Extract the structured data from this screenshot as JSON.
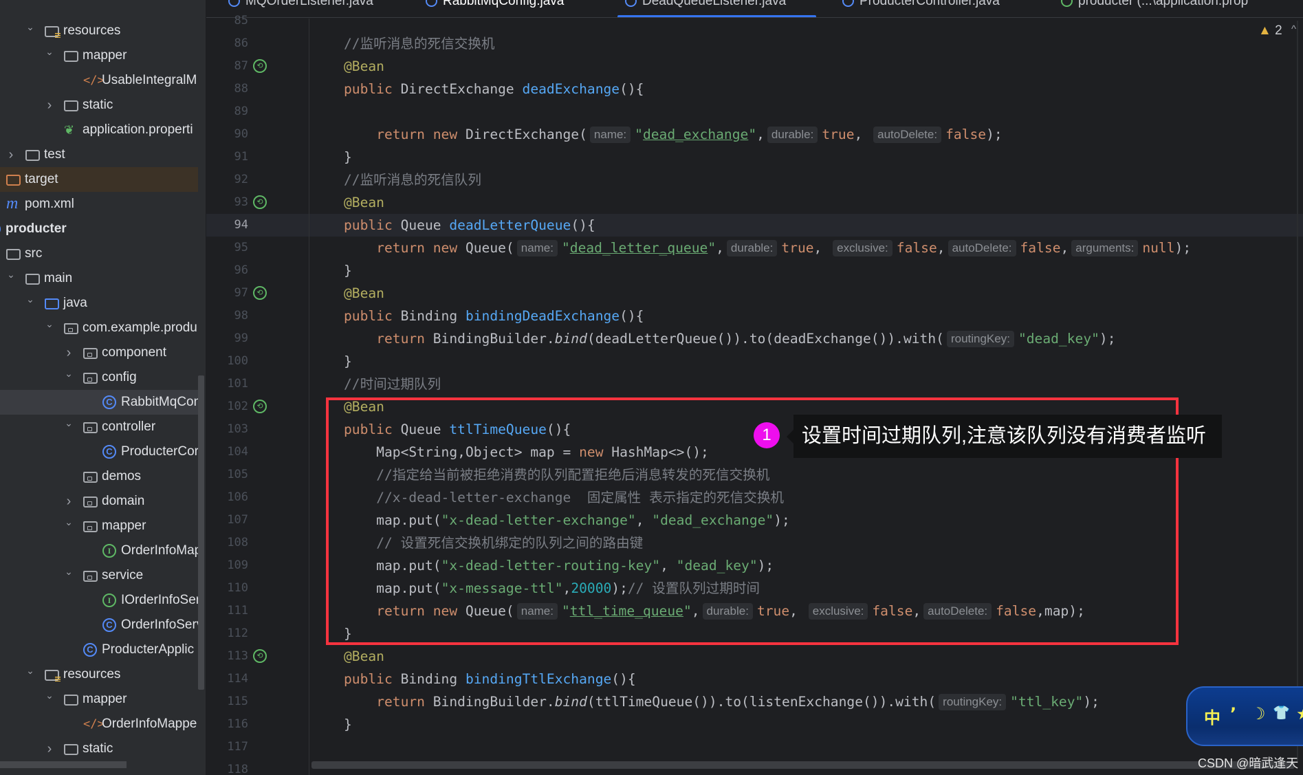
{
  "tabs": [
    {
      "label": "MQOrderListener.java",
      "active": false
    },
    {
      "label": "RabbitMqConfig.java",
      "active": true
    },
    {
      "label": "DeadQueueListener.java",
      "active": false
    },
    {
      "label": "ProducterController.java",
      "active": false
    },
    {
      "label": "producter (...\\application.prop",
      "active": false
    }
  ],
  "editor": {
    "warning_count": "2",
    "warning_icon": "warning-triangle-icon",
    "current_line": 94
  },
  "tree": [
    {
      "label": "resources",
      "level": 1,
      "chev": "open",
      "icon": "resources-folder"
    },
    {
      "label": "mapper",
      "level": 2,
      "chev": "open",
      "icon": "folder"
    },
    {
      "label": "UsableIntegralM",
      "level": 3,
      "chev": "none",
      "icon": "xml"
    },
    {
      "label": "static",
      "level": 2,
      "chev": "closed",
      "icon": "folder"
    },
    {
      "label": "application.properti",
      "level": 2,
      "chev": "none",
      "icon": "spring-properties"
    },
    {
      "label": "test",
      "level": 0,
      "chev": "closed",
      "icon": "folder"
    },
    {
      "label": "target",
      "level": -1,
      "chev": "none",
      "icon": "excluded-folder",
      "state": "target"
    },
    {
      "label": "pom.xml",
      "level": -1,
      "chev": "none",
      "icon": "maven"
    },
    {
      "label": "producter",
      "level": -2,
      "chev": "none",
      "icon": "module",
      "bold": true
    },
    {
      "label": "src",
      "level": -1,
      "chev": "none",
      "icon": "folder"
    },
    {
      "label": "main",
      "level": 0,
      "chev": "open",
      "icon": "folder"
    },
    {
      "label": "java",
      "level": 1,
      "chev": "open",
      "icon": "source-folder"
    },
    {
      "label": "com.example.produ",
      "level": 2,
      "chev": "open",
      "icon": "package"
    },
    {
      "label": "component",
      "level": 3,
      "chev": "closed",
      "icon": "package"
    },
    {
      "label": "config",
      "level": 3,
      "chev": "open",
      "icon": "package"
    },
    {
      "label": "RabbitMqCon",
      "level": 4,
      "chev": "none",
      "icon": "class",
      "state": "selected"
    },
    {
      "label": "controller",
      "level": 3,
      "chev": "open",
      "icon": "package"
    },
    {
      "label": "ProducterCor",
      "level": 4,
      "chev": "none",
      "icon": "class"
    },
    {
      "label": "demos",
      "level": 3,
      "chev": "none",
      "icon": "package"
    },
    {
      "label": "domain",
      "level": 3,
      "chev": "closed",
      "icon": "package"
    },
    {
      "label": "mapper",
      "level": 3,
      "chev": "open",
      "icon": "package"
    },
    {
      "label": "OrderInfoMap",
      "level": 4,
      "chev": "none",
      "icon": "interface"
    },
    {
      "label": "service",
      "level": 3,
      "chev": "open",
      "icon": "package"
    },
    {
      "label": "IOrderInfoSer",
      "level": 4,
      "chev": "none",
      "icon": "interface"
    },
    {
      "label": "OrderInfoServ",
      "level": 4,
      "chev": "none",
      "icon": "class"
    },
    {
      "label": "ProducterApplic",
      "level": 3,
      "chev": "none",
      "icon": "spring-class"
    },
    {
      "label": "resources",
      "level": 1,
      "chev": "open",
      "icon": "resources-folder"
    },
    {
      "label": "mapper",
      "level": 2,
      "chev": "open",
      "icon": "folder"
    },
    {
      "label": "OrderInfoMappe",
      "level": 3,
      "chev": "none",
      "icon": "xml"
    },
    {
      "label": "static",
      "level": 2,
      "chev": "closed",
      "icon": "folder"
    }
  ],
  "code": {
    "lines": [
      {
        "n": "85",
        "tokens": []
      },
      {
        "n": "86",
        "tokens": [
          {
            "t": "cm",
            "s": "//监听消息的死信交换机"
          }
        ]
      },
      {
        "n": "87",
        "bean": true,
        "tokens": [
          {
            "t": "an",
            "s": "@Bean"
          }
        ]
      },
      {
        "n": "88",
        "tokens": [
          {
            "t": "kw",
            "s": "public "
          },
          {
            "t": "p",
            "s": "DirectExchange "
          },
          {
            "t": "fn",
            "s": "deadExchange"
          },
          {
            "t": "p",
            "s": "(){"
          }
        ]
      },
      {
        "n": "89",
        "tokens": []
      },
      {
        "n": "90",
        "tokens": [
          {
            "t": "p",
            "s": "    "
          },
          {
            "t": "kw",
            "s": "return new "
          },
          {
            "t": "p",
            "s": "DirectExchange("
          },
          {
            "t": "hint",
            "s": "name:"
          },
          {
            "t": "str",
            "s": "\""
          },
          {
            "t": "stru",
            "s": "dead_exchange"
          },
          {
            "t": "str",
            "s": "\""
          },
          {
            "t": "p",
            "s": ","
          },
          {
            "t": "hint",
            "s": "durable:"
          },
          {
            "t": "kw",
            "s": "true"
          },
          {
            "t": "p",
            "s": ", "
          },
          {
            "t": "hint",
            "s": "autoDelete:"
          },
          {
            "t": "kw",
            "s": "false"
          },
          {
            "t": "p",
            "s": ");"
          }
        ]
      },
      {
        "n": "91",
        "tokens": [
          {
            "t": "p",
            "s": "}"
          }
        ]
      },
      {
        "n": "92",
        "tokens": [
          {
            "t": "cm",
            "s": "//监听消息的死信队列"
          }
        ]
      },
      {
        "n": "93",
        "bean": true,
        "tokens": [
          {
            "t": "an",
            "s": "@Bean"
          }
        ]
      },
      {
        "n": "94",
        "tokens": [
          {
            "t": "kw",
            "s": "public "
          },
          {
            "t": "p",
            "s": "Queue "
          },
          {
            "t": "fn",
            "s": "deadLetterQueue"
          },
          {
            "t": "p",
            "s": "(){"
          }
        ]
      },
      {
        "n": "95",
        "tokens": [
          {
            "t": "p",
            "s": "    "
          },
          {
            "t": "kw",
            "s": "return new "
          },
          {
            "t": "p",
            "s": "Queue("
          },
          {
            "t": "hint",
            "s": "name:"
          },
          {
            "t": "str",
            "s": "\""
          },
          {
            "t": "stru",
            "s": "dead_letter_queue"
          },
          {
            "t": "str",
            "s": "\""
          },
          {
            "t": "p",
            "s": ","
          },
          {
            "t": "hint",
            "s": "durable:"
          },
          {
            "t": "kw",
            "s": "true"
          },
          {
            "t": "p",
            "s": ", "
          },
          {
            "t": "hint",
            "s": "exclusive:"
          },
          {
            "t": "kw",
            "s": "false"
          },
          {
            "t": "p",
            "s": ","
          },
          {
            "t": "hint",
            "s": "autoDelete:"
          },
          {
            "t": "kw",
            "s": "false"
          },
          {
            "t": "p",
            "s": ","
          },
          {
            "t": "hint",
            "s": "arguments:"
          },
          {
            "t": "kw",
            "s": "null"
          },
          {
            "t": "p",
            "s": ");"
          }
        ]
      },
      {
        "n": "96",
        "tokens": [
          {
            "t": "p",
            "s": "}"
          }
        ]
      },
      {
        "n": "97",
        "bean": true,
        "tokens": [
          {
            "t": "an",
            "s": "@Bean"
          }
        ]
      },
      {
        "n": "98",
        "tokens": [
          {
            "t": "kw",
            "s": "public "
          },
          {
            "t": "p",
            "s": "Binding "
          },
          {
            "t": "fn",
            "s": "bindingDeadExchange"
          },
          {
            "t": "p",
            "s": "(){"
          }
        ]
      },
      {
        "n": "99",
        "tokens": [
          {
            "t": "p",
            "s": "    "
          },
          {
            "t": "kw",
            "s": "return "
          },
          {
            "t": "p",
            "s": "BindingBuilder."
          },
          {
            "t": "it",
            "s": "bind"
          },
          {
            "t": "p",
            "s": "(deadLetterQueue()).to(deadExchange()).with("
          },
          {
            "t": "hint",
            "s": "routingKey:"
          },
          {
            "t": "str",
            "s": "\"dead_key\""
          },
          {
            "t": "p",
            "s": ");"
          }
        ]
      },
      {
        "n": "100",
        "tokens": [
          {
            "t": "p",
            "s": "}"
          }
        ]
      },
      {
        "n": "101",
        "tokens": [
          {
            "t": "cm",
            "s": "//时间过期队列"
          }
        ]
      },
      {
        "n": "102",
        "bean": true,
        "tokens": [
          {
            "t": "an",
            "s": "@Bean"
          }
        ]
      },
      {
        "n": "103",
        "tokens": [
          {
            "t": "kw",
            "s": "public "
          },
          {
            "t": "p",
            "s": "Queue "
          },
          {
            "t": "fn",
            "s": "ttlTimeQueue"
          },
          {
            "t": "p",
            "s": "(){"
          }
        ]
      },
      {
        "n": "104",
        "tokens": [
          {
            "t": "p",
            "s": "    Map<String,Object> map = "
          },
          {
            "t": "kw",
            "s": "new "
          },
          {
            "t": "p",
            "s": "HashMap<>();"
          }
        ]
      },
      {
        "n": "105",
        "tokens": [
          {
            "t": "p",
            "s": "    "
          },
          {
            "t": "cm",
            "s": "//指定给当前被拒绝消费的队列配置拒绝后消息转发的死信交换机"
          }
        ]
      },
      {
        "n": "106",
        "tokens": [
          {
            "t": "p",
            "s": "    "
          },
          {
            "t": "cm",
            "s": "//x-dead-letter-exchange  固定属性 表示指定的死信交换机"
          }
        ]
      },
      {
        "n": "107",
        "tokens": [
          {
            "t": "p",
            "s": "    map.put("
          },
          {
            "t": "str",
            "s": "\"x-dead-letter-exchange\""
          },
          {
            "t": "p",
            "s": ", "
          },
          {
            "t": "str",
            "s": "\"dead_exchange\""
          },
          {
            "t": "p",
            "s": ");"
          }
        ]
      },
      {
        "n": "108",
        "tokens": [
          {
            "t": "p",
            "s": "    "
          },
          {
            "t": "cm",
            "s": "// 设置死信交换机绑定的队列之间的路由键"
          }
        ]
      },
      {
        "n": "109",
        "tokens": [
          {
            "t": "p",
            "s": "    map.put("
          },
          {
            "t": "str",
            "s": "\"x-dead-letter-routing-key\""
          },
          {
            "t": "p",
            "s": ", "
          },
          {
            "t": "str",
            "s": "\"dead_key\""
          },
          {
            "t": "p",
            "s": ");"
          }
        ]
      },
      {
        "n": "110",
        "tokens": [
          {
            "t": "p",
            "s": "    map.put("
          },
          {
            "t": "str",
            "s": "\"x-message-ttl\""
          },
          {
            "t": "p",
            "s": ","
          },
          {
            "t": "num",
            "s": "20000"
          },
          {
            "t": "p",
            "s": ");"
          },
          {
            "t": "cm",
            "s": "// 设置队列过期时间"
          }
        ]
      },
      {
        "n": "111",
        "tokens": [
          {
            "t": "p",
            "s": "    "
          },
          {
            "t": "kw",
            "s": "return new "
          },
          {
            "t": "p",
            "s": "Queue("
          },
          {
            "t": "hint",
            "s": "name:"
          },
          {
            "t": "str",
            "s": "\""
          },
          {
            "t": "stru",
            "s": "ttl_time_queue"
          },
          {
            "t": "str",
            "s": "\""
          },
          {
            "t": "p",
            "s": ","
          },
          {
            "t": "hint",
            "s": "durable:"
          },
          {
            "t": "kw",
            "s": "true"
          },
          {
            "t": "p",
            "s": ", "
          },
          {
            "t": "hint",
            "s": "exclusive:"
          },
          {
            "t": "kw",
            "s": "false"
          },
          {
            "t": "p",
            "s": ","
          },
          {
            "t": "hint",
            "s": "autoDelete:"
          },
          {
            "t": "kw",
            "s": "false"
          },
          {
            "t": "p",
            "s": ",map);"
          }
        ]
      },
      {
        "n": "112",
        "tokens": [
          {
            "t": "p",
            "s": "}"
          }
        ]
      },
      {
        "n": "113",
        "bean": true,
        "tokens": [
          {
            "t": "an",
            "s": "@Bean"
          }
        ]
      },
      {
        "n": "114",
        "tokens": [
          {
            "t": "kw",
            "s": "public "
          },
          {
            "t": "p",
            "s": "Binding "
          },
          {
            "t": "fn",
            "s": "bindingTtlExchange"
          },
          {
            "t": "p",
            "s": "(){"
          }
        ]
      },
      {
        "n": "115",
        "tokens": [
          {
            "t": "p",
            "s": "    "
          },
          {
            "t": "kw",
            "s": "return "
          },
          {
            "t": "p",
            "s": "BindingBuilder."
          },
          {
            "t": "it",
            "s": "bind"
          },
          {
            "t": "p",
            "s": "(ttlTimeQueue()).to(listenExchange()).with("
          },
          {
            "t": "hint",
            "s": "routingKey:"
          },
          {
            "t": "str",
            "s": "\"ttl_key\""
          },
          {
            "t": "p",
            "s": ");"
          }
        ]
      },
      {
        "n": "116",
        "tokens": [
          {
            "t": "p",
            "s": "}"
          }
        ]
      },
      {
        "n": "117",
        "tokens": []
      },
      {
        "n": "118",
        "tokens": []
      }
    ]
  },
  "annotation": {
    "badge": "1",
    "text": "设置时间过期队列,注意该队列没有消费者监听",
    "box_color": "#F5333F",
    "badge_color": "#EE0EEE"
  },
  "ime": {
    "items": [
      "中",
      "٬",
      "☽",
      "👕",
      "★"
    ]
  },
  "watermark": "CSDN @暗武逢天"
}
